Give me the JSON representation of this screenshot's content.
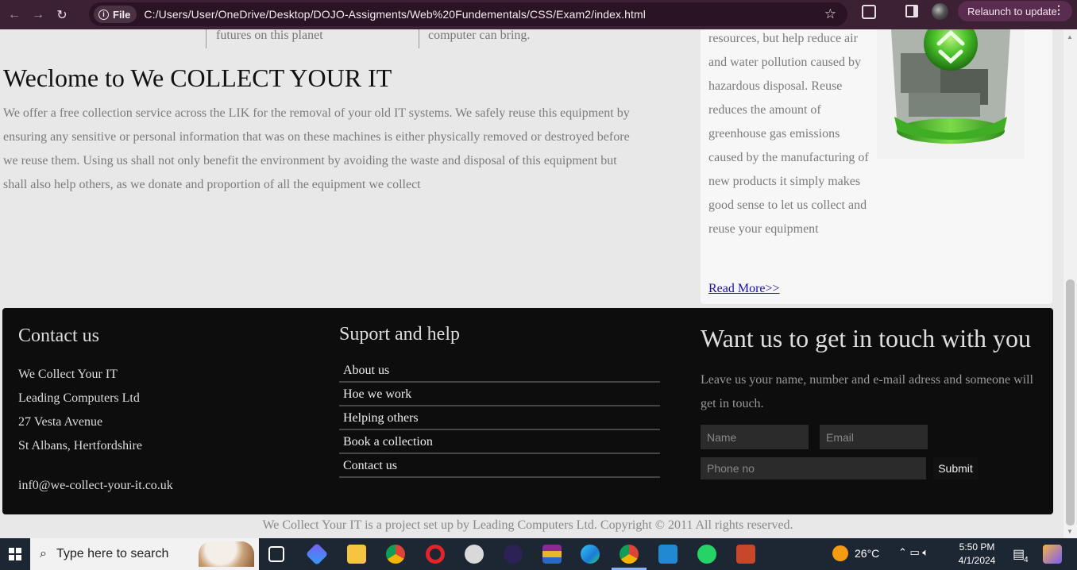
{
  "browser": {
    "url_chip": "File",
    "url": "C:/Users/User/OneDrive/Desktop/DOJO-Assigments/Web%20Fundementals/CSS/Exam2/index.html",
    "relaunch_label": "Relaunch to update"
  },
  "top_fragments": {
    "left": "futures on this planet",
    "right": "computer can bring."
  },
  "welcome": {
    "title": "Weclome to We COLLECT YOUR IT",
    "text": "We offer a free collection service across the LIK for the removal of your old IT systems. We safely reuse this equipment by ensuring any sensitive or personal information that was on these machines is either physically removed or destroyed before we reuse them. Using us shall not only benefit the environment by avoiding the waste and disposal of this equipment but shall also help others, as we donate and proportion of all the equipment we collect"
  },
  "sidebar": {
    "text": "resources, but help reduce air and water pollution caused by hazardous disposal. Reuse reduces the amount of greenhouse gas emissions caused by the manufacturing of new products it simply makes good sense to let us collect and reuse your equipment",
    "read_more": "Read More>>"
  },
  "footer": {
    "contact": {
      "title": "Contact us",
      "lines": [
        "We Collect Your IT",
        "Leading Computers Ltd",
        "27 Vesta Avenue",
        "St Albans, Hertfordshire"
      ],
      "email": "inf0@we-collect-your-it.co.uk"
    },
    "support": {
      "title": "Suport and help",
      "items": [
        "About us",
        "Hoe we work",
        "Helping others",
        "Book a collection",
        "Contact us"
      ]
    },
    "touch": {
      "title": "Want us to get in touch with you",
      "text": "Leave us your name, number and e-mail adress and someone will get in touch.",
      "name_placeholder": "Name",
      "email_placeholder": "Email",
      "phone_placeholder": "Phone no",
      "submit_label": "Submit"
    }
  },
  "copyright": "We Collect Your IT is a project set up by Leading Computers Ltd. Copyright © 2011 All rights reserved.",
  "taskbar": {
    "search_placeholder": "Type here to search",
    "weather_temp": "26°C",
    "time": "5:50 PM",
    "date": "4/1/2024",
    "notif_count": "4"
  }
}
